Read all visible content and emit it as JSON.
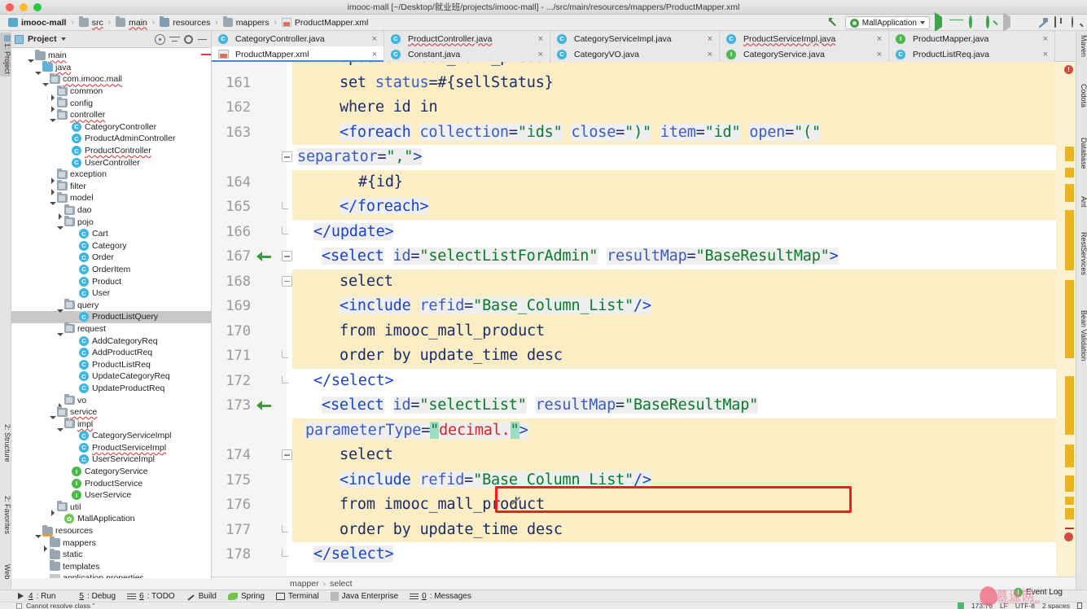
{
  "window": {
    "title": "imooc-mall [~/Desktop/就业班/projects/imooc-mall] - .../src/main/resources/mappers/ProductMapper.xml"
  },
  "breadcrumb": {
    "items": [
      {
        "label": "imooc-mall",
        "icon": "module-icon"
      },
      {
        "label": "src",
        "icon": "folder-icon"
      },
      {
        "label": "main",
        "icon": "folder-icon"
      },
      {
        "label": "resources",
        "icon": "folder-icon"
      },
      {
        "label": "mappers",
        "icon": "folder-icon"
      },
      {
        "label": "ProductMapper.xml",
        "icon": "xml-file-icon"
      }
    ],
    "separator": "›"
  },
  "run_toolbar": {
    "configuration": "MallApplication",
    "icons": [
      "update-arrow-icon",
      "run-icon",
      "debug-icon",
      "run-with-coverage-icon",
      "profile-icon",
      "rerun-icon",
      "stop-icon",
      "build-icon",
      "layout-icon",
      "search-everywhere-icon"
    ]
  },
  "left_tool_strip": {
    "items": [
      {
        "label": "1: Project",
        "active": true
      },
      {
        "label": "2: Structure",
        "active": false
      },
      {
        "label": "2: Favorites",
        "active": false
      },
      {
        "label": "Web",
        "active": false
      }
    ]
  },
  "right_tool_strip": {
    "items": [
      {
        "label": "Maven"
      },
      {
        "label": "Codota"
      },
      {
        "label": "Database"
      },
      {
        "label": "Ant"
      },
      {
        "label": "RestServices"
      },
      {
        "label": "Bean Validation"
      }
    ]
  },
  "project_panel": {
    "title": "Project",
    "header_icons": [
      "locate-icon",
      "collapse-all-icon",
      "gear-icon",
      "minimize-icon"
    ],
    "tree": [
      {
        "label": "main",
        "indent": 2,
        "twisty": "down",
        "icon": "folder",
        "underline": true
      },
      {
        "label": "java",
        "indent": 3,
        "twisty": "down",
        "icon": "folder-blue",
        "underline": true
      },
      {
        "label": "com.imooc.mall",
        "indent": 4,
        "twisty": "down",
        "icon": "pkg",
        "underline": true
      },
      {
        "label": "common",
        "indent": 5,
        "twisty": "right",
        "icon": "pkg",
        "underline": false
      },
      {
        "label": "config",
        "indent": 5,
        "twisty": "right",
        "icon": "pkg",
        "underline": false
      },
      {
        "label": "controller",
        "indent": 5,
        "twisty": "down",
        "icon": "pkg",
        "underline": true
      },
      {
        "label": "CategoryController",
        "indent": 7,
        "twisty": "none",
        "icon": "class",
        "underline": false
      },
      {
        "label": "ProductAdminController",
        "indent": 7,
        "twisty": "none",
        "icon": "class",
        "underline": false
      },
      {
        "label": "ProductController",
        "indent": 7,
        "twisty": "none",
        "icon": "class",
        "underline": true,
        "mark": true
      },
      {
        "label": "UserController",
        "indent": 7,
        "twisty": "none",
        "icon": "class",
        "underline": false
      },
      {
        "label": "exception",
        "indent": 5,
        "twisty": "right",
        "icon": "pkg",
        "underline": false
      },
      {
        "label": "filter",
        "indent": 5,
        "twisty": "right",
        "icon": "pkg",
        "underline": false
      },
      {
        "label": "model",
        "indent": 5,
        "twisty": "down",
        "icon": "pkg",
        "underline": false
      },
      {
        "label": "dao",
        "indent": 6,
        "twisty": "right",
        "icon": "pkg",
        "underline": false
      },
      {
        "label": "pojo",
        "indent": 6,
        "twisty": "down",
        "icon": "pkg",
        "underline": false
      },
      {
        "label": "Cart",
        "indent": 8,
        "twisty": "none",
        "icon": "class",
        "underline": false
      },
      {
        "label": "Category",
        "indent": 8,
        "twisty": "none",
        "icon": "class",
        "underline": false
      },
      {
        "label": "Order",
        "indent": 8,
        "twisty": "none",
        "icon": "class",
        "underline": false
      },
      {
        "label": "OrderItem",
        "indent": 8,
        "twisty": "none",
        "icon": "class",
        "underline": false
      },
      {
        "label": "Product",
        "indent": 8,
        "twisty": "none",
        "icon": "class",
        "underline": false
      },
      {
        "label": "User",
        "indent": 8,
        "twisty": "none",
        "icon": "class",
        "underline": false
      },
      {
        "label": "query",
        "indent": 6,
        "twisty": "down",
        "icon": "pkg",
        "underline": false
      },
      {
        "label": "ProductListQuery",
        "indent": 8,
        "twisty": "none",
        "icon": "class",
        "underline": false,
        "selected": true
      },
      {
        "label": "request",
        "indent": 6,
        "twisty": "down",
        "icon": "pkg",
        "underline": false
      },
      {
        "label": "AddCategoryReq",
        "indent": 8,
        "twisty": "none",
        "icon": "class",
        "underline": false
      },
      {
        "label": "AddProductReq",
        "indent": 8,
        "twisty": "none",
        "icon": "class",
        "underline": false
      },
      {
        "label": "ProductListReq",
        "indent": 8,
        "twisty": "none",
        "icon": "class",
        "underline": false,
        "mark": true
      },
      {
        "label": "UpdateCategoryReq",
        "indent": 8,
        "twisty": "none",
        "icon": "class",
        "underline": false
      },
      {
        "label": "UpdateProductReq",
        "indent": 8,
        "twisty": "none",
        "icon": "class",
        "underline": false
      },
      {
        "label": "vo",
        "indent": 6,
        "twisty": "right",
        "icon": "pkg",
        "underline": false
      },
      {
        "label": "service",
        "indent": 5,
        "twisty": "down",
        "icon": "pkg",
        "underline": true
      },
      {
        "label": "impl",
        "indent": 6,
        "twisty": "down",
        "icon": "pkg",
        "underline": true
      },
      {
        "label": "CategoryServiceImpl",
        "indent": 8,
        "twisty": "none",
        "icon": "class",
        "underline": false
      },
      {
        "label": "ProductServiceImpl",
        "indent": 8,
        "twisty": "none",
        "icon": "class",
        "underline": true
      },
      {
        "label": "UserServiceImpl",
        "indent": 8,
        "twisty": "none",
        "icon": "class",
        "underline": false
      },
      {
        "label": "CategoryService",
        "indent": 7,
        "twisty": "none",
        "icon": "interface",
        "underline": false
      },
      {
        "label": "ProductService",
        "indent": 7,
        "twisty": "none",
        "icon": "interface",
        "underline": false
      },
      {
        "label": "UserService",
        "indent": 7,
        "twisty": "none",
        "icon": "interface",
        "underline": false
      },
      {
        "label": "util",
        "indent": 5,
        "twisty": "right",
        "icon": "pkg",
        "underline": false
      },
      {
        "label": "MallApplication",
        "indent": 6,
        "twisty": "none",
        "icon": "spring",
        "underline": false
      },
      {
        "label": "resources",
        "indent": 3,
        "twisty": "down",
        "icon": "folder-src",
        "underline": false
      },
      {
        "label": "mappers",
        "indent": 4,
        "twisty": "right",
        "icon": "folder",
        "underline": false
      },
      {
        "label": "static",
        "indent": 4,
        "twisty": "none",
        "icon": "folder",
        "underline": false
      },
      {
        "label": "templates",
        "indent": 4,
        "twisty": "none",
        "icon": "folder",
        "underline": false
      },
      {
        "label": "application.properties",
        "indent": 4,
        "twisty": "none",
        "icon": "properties",
        "underline": false
      }
    ]
  },
  "editor_tabs": {
    "row1": [
      {
        "label": "CategoryController.java",
        "icon": "class",
        "active": false,
        "underline": false
      },
      {
        "label": "ProductController.java",
        "icon": "class",
        "active": false,
        "underline": true
      },
      {
        "label": "CategoryServiceImpl.java",
        "icon": "class",
        "active": false,
        "underline": false
      },
      {
        "label": "ProductServiceImpl.java",
        "icon": "class",
        "active": false,
        "underline": true
      },
      {
        "label": "ProductMapper.java",
        "icon": "interface",
        "active": false,
        "underline": false
      }
    ],
    "row2": [
      {
        "label": "ProductMapper.xml",
        "icon": "xml",
        "active": true,
        "underline": false
      },
      {
        "label": "Constant.java",
        "icon": "class",
        "active": false,
        "underline": false
      },
      {
        "label": "CategoryVO.java",
        "icon": "class",
        "active": false,
        "underline": false
      },
      {
        "label": "CategoryService.java",
        "icon": "interface",
        "active": false,
        "underline": false
      },
      {
        "label": "ProductListReq.java",
        "icon": "class",
        "active": false,
        "underline": false
      }
    ],
    "close_glyph": "×"
  },
  "code": {
    "lines": [
      {
        "num": "160",
        "text": "update imooc_mall_product",
        "clipped": true
      },
      {
        "num": "161",
        "text": "set status=#{sellStatus}"
      },
      {
        "num": "162",
        "text": "where id in"
      },
      {
        "num": "163",
        "text": "<foreach collection=\"ids\" close=\")\" item=\"id\" open=\"(\""
      },
      {
        "num": "",
        "text": "separator=\",\">",
        "wrapped": true
      },
      {
        "num": "164",
        "text": "#{id}"
      },
      {
        "num": "165",
        "text": "</foreach>"
      },
      {
        "num": "166",
        "text": "</update>"
      },
      {
        "num": "167",
        "text": "<select id=\"selectListForAdmin\" resultMap=\"BaseResultMap\">"
      },
      {
        "num": "168",
        "text": "select"
      },
      {
        "num": "169",
        "text": "<include refid=\"Base_Column_List\"/>"
      },
      {
        "num": "170",
        "text": "from imooc_mall_product"
      },
      {
        "num": "171",
        "text": "order by update_time desc"
      },
      {
        "num": "172",
        "text": "</select>"
      },
      {
        "num": "173",
        "text": "<select id=\"selectList\" resultMap=\"BaseResultMap\""
      },
      {
        "num": "",
        "text": "parameterType=\"decimal.\">",
        "wrapped": true,
        "error": true
      },
      {
        "num": "174",
        "text": "select"
      },
      {
        "num": "175",
        "text": "<include refid=\"Base_Column_List\"/>"
      },
      {
        "num": "176",
        "text": "from imooc_mall_product"
      },
      {
        "num": "177",
        "text": "order by update_time desc"
      },
      {
        "num": "178",
        "text": "</select>"
      }
    ],
    "highlight_box_color": "#f21e1e",
    "error_token": "decimal."
  },
  "editor_breadcrumb": {
    "items": [
      "mapper",
      "select"
    ],
    "separator": "›"
  },
  "bottom_toolwindows": {
    "items": [
      {
        "num": "4",
        "label": ": Run",
        "icon": "run-icon"
      },
      {
        "num": "5",
        "label": ": Debug",
        "icon": "debug-icon"
      },
      {
        "num": "6",
        "label": ": TODO",
        "icon": "todo-icon"
      },
      {
        "num": "",
        "label": "Build",
        "icon": "build-icon"
      },
      {
        "num": "",
        "label": "Spring",
        "icon": "spring-icon"
      },
      {
        "num": "",
        "label": "Terminal",
        "icon": "terminal-icon"
      },
      {
        "num": "",
        "label": "Java Enterprise",
        "icon": "jee-icon"
      },
      {
        "num": "0",
        "label": ": Messages",
        "icon": "messages-icon"
      }
    ]
  },
  "status_bar": {
    "message": "Cannot resolve class ''",
    "caret": "173:76",
    "line_separator": "LF",
    "encoding": "UTF-8",
    "indent": "2 spaces",
    "event_log": "Event Log"
  },
  "watermark": {
    "text": "慕课网",
    "sub": "IMOOC.COM"
  },
  "colors": {
    "accent": "#4688d8",
    "error": "#d22424",
    "highlight_band": "#f7e2a4",
    "tag": "#1a43c8",
    "attr_value": "#0c7a2d",
    "plain": "#1b2b6b",
    "box": "#f21e1e"
  }
}
